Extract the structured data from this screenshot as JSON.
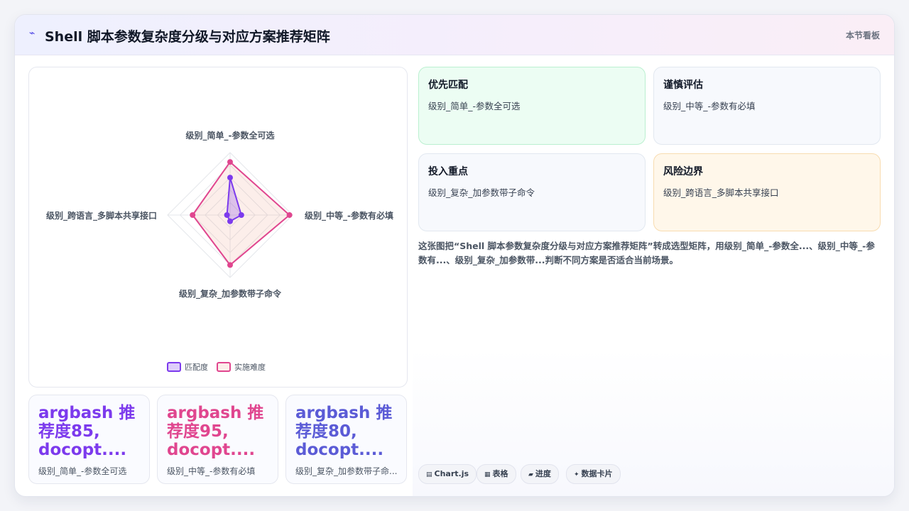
{
  "header": {
    "title": "Shell 脚本参数复杂度分级与对应方案推荐矩阵",
    "right_link": "本节看板",
    "logo_icon": "sparkle-icon"
  },
  "chart_data": {
    "type": "radar",
    "categories": [
      "级别_简单_-参数全可选",
      "级别_中等_-参数有必填",
      "级别_复杂_加参数带子命令",
      "级别_跨语言_多脚本共享接口"
    ],
    "series": [
      {
        "name": "匹配度",
        "values": [
          60,
          18,
          10,
          5
        ],
        "color": "#7c3aed"
      },
      {
        "name": "实施难度",
        "values": [
          85,
          95,
          80,
          60
        ],
        "color": "#e0468f"
      }
    ],
    "rlim": [
      0,
      100
    ],
    "legend_position": "bottom"
  },
  "stats": [
    {
      "big": "argbash 推荐度85, docopt....",
      "sub": "级别_简单_-参数全可选",
      "color": "#7c3aed"
    },
    {
      "big": "argbash 推荐度95, docopt....",
      "sub": "级别_中等_-参数有必填",
      "color": "#e0468f"
    },
    {
      "big": "argbash 推荐度80, docopt....",
      "sub": "级别_复杂_加参数带子命...",
      "color": "#5b5bd6"
    }
  ],
  "recommendations": [
    {
      "title": "优先匹配",
      "value": "级别_简单_-参数全可选",
      "bg": "#ecfdf3",
      "border": "#bbf0d0"
    },
    {
      "title": "谨慎评估",
      "value": "级别_中等_-参数有必填",
      "bg": "#f7f9fd",
      "border": "#e2e8f0"
    },
    {
      "title": "投入重点",
      "value": "级别_复杂_加参数带子命令",
      "bg": "#f7f9fd",
      "border": "#e2e8f0"
    },
    {
      "title": "风险边界",
      "value": "级别_跨语言_多脚本共享接口",
      "bg": "#fff7ea",
      "border": "#f8dcb0"
    }
  ],
  "description": "这张图把“Shell 脚本参数复杂度分级与对应方案推荐矩阵”转成选型矩阵，用级别_简单_-参数全...、级别_中等_-参数有...、级别_复杂_加参数带...判断不同方案是否适合当前场景。",
  "tags": [
    {
      "icon": "▤",
      "label": "Chart.js"
    },
    {
      "icon": "▦",
      "label": "表格"
    },
    {
      "icon": "▰",
      "label": "进度"
    },
    {
      "icon": "✦",
      "label": "数据卡片"
    }
  ]
}
